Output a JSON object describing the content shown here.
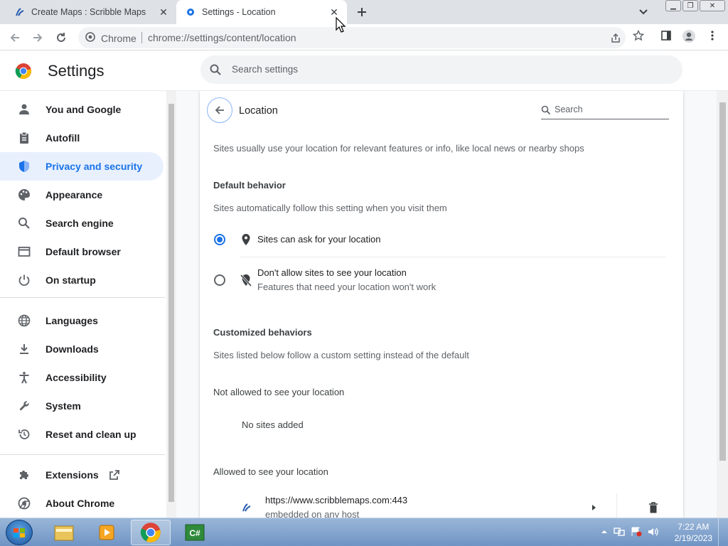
{
  "tabs": [
    {
      "title": "Create Maps : Scribble Maps",
      "icon": "scribble-maps-icon"
    },
    {
      "title": "Settings - Location",
      "icon": "gear-icon",
      "active": true
    }
  ],
  "omnibox": {
    "site_label": "Chrome",
    "url": "chrome://settings/content/location"
  },
  "header": {
    "title": "Settings",
    "search_placeholder": "Search settings"
  },
  "sidebar": {
    "items": [
      {
        "label": "You and Google",
        "icon": "person-icon"
      },
      {
        "label": "Autofill",
        "icon": "clipboard-icon"
      },
      {
        "label": "Privacy and security",
        "icon": "shield-icon",
        "selected": true
      },
      {
        "label": "Appearance",
        "icon": "palette-icon"
      },
      {
        "label": "Search engine",
        "icon": "search-icon"
      },
      {
        "label": "Default browser",
        "icon": "browser-icon"
      },
      {
        "label": "On startup",
        "icon": "power-icon"
      },
      {
        "label": "Languages",
        "icon": "globe-icon"
      },
      {
        "label": "Downloads",
        "icon": "download-icon"
      },
      {
        "label": "Accessibility",
        "icon": "accessibility-icon"
      },
      {
        "label": "System",
        "icon": "wrench-icon"
      },
      {
        "label": "Reset and clean up",
        "icon": "history-icon"
      },
      {
        "label": "Extensions",
        "icon": "puzzle-icon"
      },
      {
        "label": "About Chrome",
        "icon": "chrome-icon"
      }
    ]
  },
  "content": {
    "title": "Location",
    "search_placeholder": "Search",
    "description": "Sites usually use your location for relevant features or info, like local news or nearby shops",
    "default_heading": "Default behavior",
    "default_sub": "Sites automatically follow this setting when you visit them",
    "option_allow": "Sites can ask for your location",
    "option_block": "Don't allow sites to see your location",
    "option_block_sub": "Features that need your location won't work",
    "custom_heading": "Customized behaviors",
    "custom_sub": "Sites listed below follow a custom setting instead of the default",
    "not_allowed_heading": "Not allowed to see your location",
    "no_sites": "No sites added",
    "allowed_heading": "Allowed to see your location",
    "allowed_site": {
      "url": "https://www.scribblemaps.com:443",
      "sub": "embedded on any host"
    }
  },
  "taskbar": {
    "time": "7:22 AM",
    "date": "2/19/2023"
  },
  "colors": {
    "accent": "#1a73e8",
    "selected_bg": "#e8f0fe"
  }
}
